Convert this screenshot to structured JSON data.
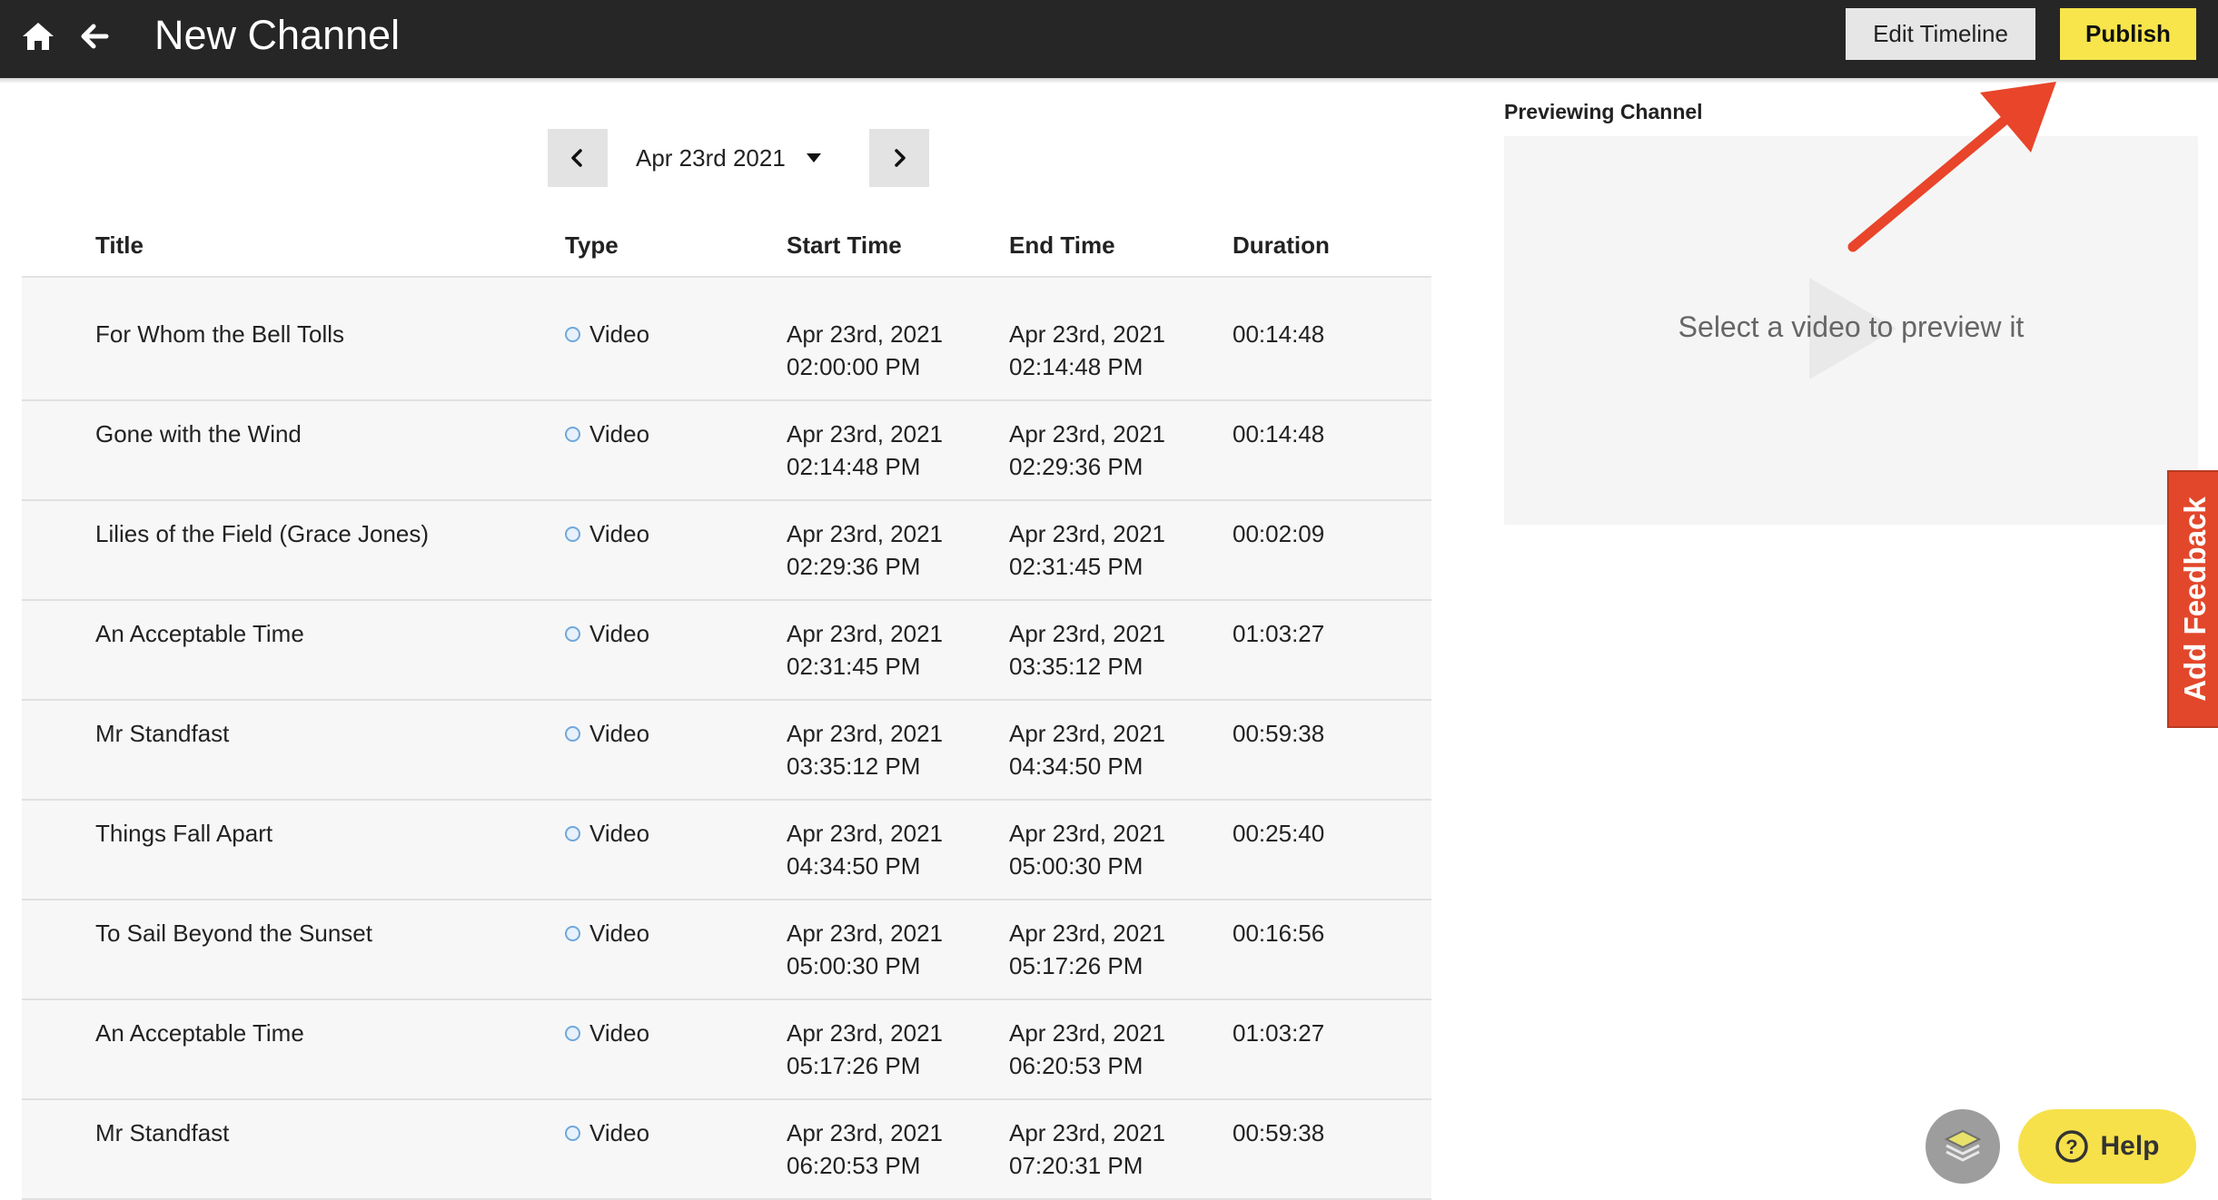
{
  "header": {
    "title": "New Channel",
    "edit_timeline_label": "Edit Timeline",
    "publish_label": "Publish",
    "home_icon": "home-icon",
    "back_icon": "arrow-left-icon"
  },
  "date_nav": {
    "selected_date": "Apr 23rd 2021",
    "prev_icon": "chevron-left-icon",
    "next_icon": "chevron-right-icon",
    "dropdown_icon": "caret-down-icon"
  },
  "schedule_table": {
    "columns": [
      "Title",
      "Type",
      "Start Time",
      "End Time",
      "Duration"
    ],
    "rows": [
      {
        "title": "For Whom the Bell Tolls",
        "type": "Video",
        "start_date": "Apr 23rd, 2021",
        "start_time": "02:00:00 PM",
        "end_date": "Apr 23rd, 2021",
        "end_time": "02:14:48 PM",
        "duration": "00:14:48"
      },
      {
        "title": "Gone with the Wind",
        "type": "Video",
        "start_date": "Apr 23rd, 2021",
        "start_time": "02:14:48 PM",
        "end_date": "Apr 23rd, 2021",
        "end_time": "02:29:36 PM",
        "duration": "00:14:48"
      },
      {
        "title": "Lilies of the Field (Grace Jones)",
        "type": "Video",
        "start_date": "Apr 23rd, 2021",
        "start_time": "02:29:36 PM",
        "end_date": "Apr 23rd, 2021",
        "end_time": "02:31:45 PM",
        "duration": "00:02:09"
      },
      {
        "title": "An Acceptable Time",
        "type": "Video",
        "start_date": "Apr 23rd, 2021",
        "start_time": "02:31:45 PM",
        "end_date": "Apr 23rd, 2021",
        "end_time": "03:35:12 PM",
        "duration": "01:03:27"
      },
      {
        "title": "Mr Standfast",
        "type": "Video",
        "start_date": "Apr 23rd, 2021",
        "start_time": "03:35:12 PM",
        "end_date": "Apr 23rd, 2021",
        "end_time": "04:34:50 PM",
        "duration": "00:59:38"
      },
      {
        "title": "Things Fall Apart",
        "type": "Video",
        "start_date": "Apr 23rd, 2021",
        "start_time": "04:34:50 PM",
        "end_date": "Apr 23rd, 2021",
        "end_time": "05:00:30 PM",
        "duration": "00:25:40"
      },
      {
        "title": "To Sail Beyond the Sunset",
        "type": "Video",
        "start_date": "Apr 23rd, 2021",
        "start_time": "05:00:30 PM",
        "end_date": "Apr 23rd, 2021",
        "end_time": "05:17:26 PM",
        "duration": "00:16:56"
      },
      {
        "title": "An Acceptable Time",
        "type": "Video",
        "start_date": "Apr 23rd, 2021",
        "start_time": "05:17:26 PM",
        "end_date": "Apr 23rd, 2021",
        "end_time": "06:20:53 PM",
        "duration": "01:03:27"
      },
      {
        "title": "Mr Standfast",
        "type": "Video",
        "start_date": "Apr 23rd, 2021",
        "start_time": "06:20:53 PM",
        "end_date": "Apr 23rd, 2021",
        "end_time": "07:20:31 PM",
        "duration": "00:59:38"
      }
    ]
  },
  "preview": {
    "heading": "Previewing Channel",
    "placeholder": "Select a video to preview it",
    "play_icon": "play-icon"
  },
  "feedback": {
    "label": "Add Feedback"
  },
  "help": {
    "label": "Help",
    "icon": "question-circle-icon",
    "stack_icon": "stack-icon"
  },
  "colors": {
    "topbar": "#262626",
    "publish": "#f7e54b",
    "feedback": "#e2472b",
    "annotation_arrow": "#e8452b",
    "help": "#f6e14b"
  }
}
